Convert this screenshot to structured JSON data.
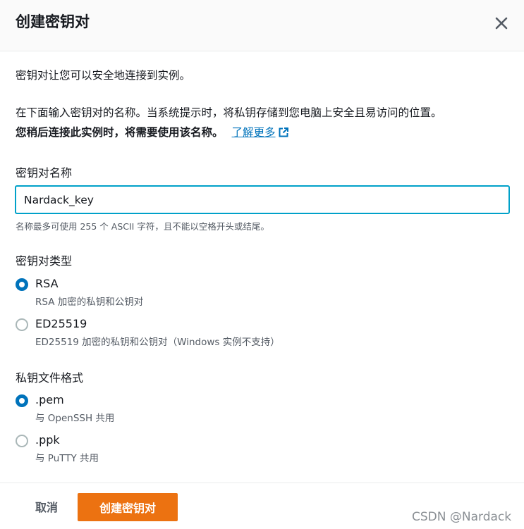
{
  "header": {
    "title": "创建密钥对"
  },
  "intro": {
    "line1": "密钥对让您可以安全地连接到实例。",
    "line2": "在下面输入密钥对的名称。当系统提示时，将私钥存储到您电脑上安全且易访问的位置。",
    "line3_bold": "您稍后连接此实例时，将需要使用该名称。",
    "learn_more": "了解更多"
  },
  "key_name": {
    "label": "密钥对名称",
    "value": "Nardack_key",
    "constraint": "名称最多可使用 255 个 ASCII 字符，且不能以空格开头或结尾。"
  },
  "key_type": {
    "label": "密钥对类型",
    "options": [
      {
        "label": "RSA",
        "description": "RSA 加密的私钥和公钥对",
        "checked": true
      },
      {
        "label": "ED25519",
        "description": "ED25519 加密的私钥和公钥对（Windows 实例不支持）",
        "checked": false
      }
    ]
  },
  "file_format": {
    "label": "私钥文件格式",
    "options": [
      {
        "label": ".pem",
        "description": "与 OpenSSH 共用",
        "checked": true
      },
      {
        "label": ".ppk",
        "description": "与 PuTTY 共用",
        "checked": false
      }
    ]
  },
  "footer": {
    "cancel_label": "取消",
    "create_label": "创建密钥对",
    "watermark": "CSDN @Nardack"
  },
  "colors": {
    "accent": "#0073bb",
    "primary_button": "#ec7211",
    "focus_border": "#00a1c9",
    "secondary_text": "#545b64"
  }
}
